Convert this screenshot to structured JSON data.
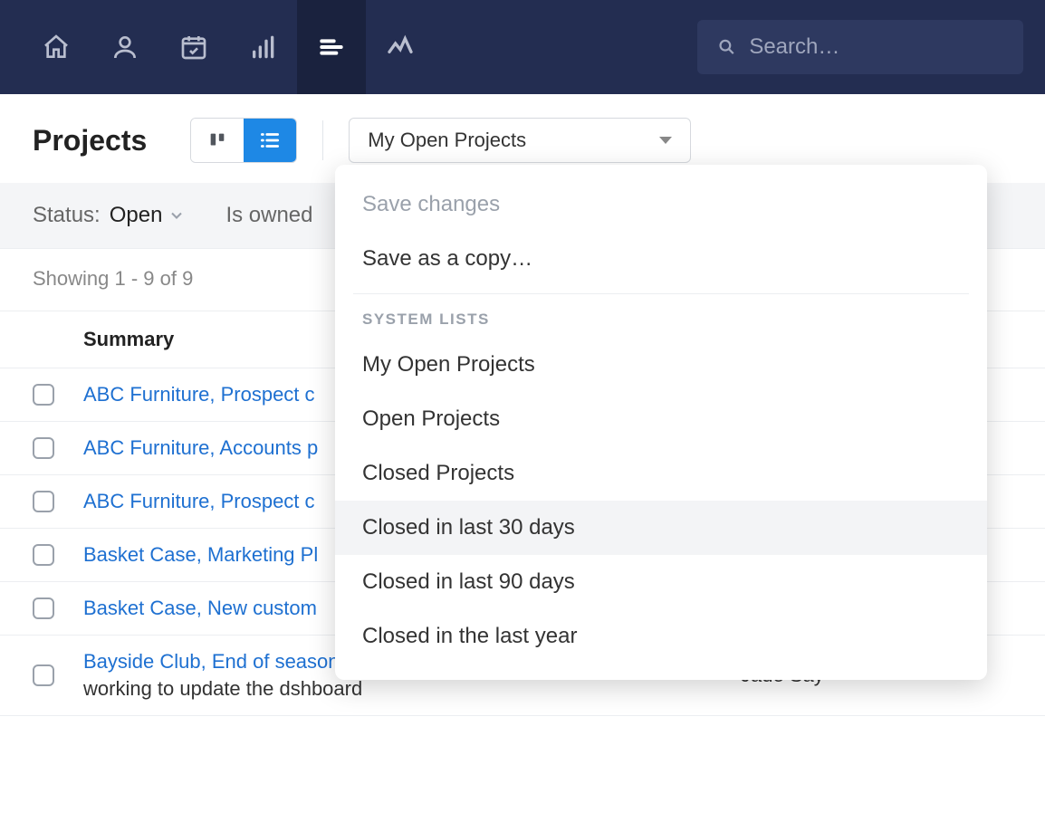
{
  "navbar": {
    "search_placeholder": "Search…"
  },
  "header": {
    "title": "Projects",
    "filter_selected": "My Open Projects"
  },
  "filterbar": {
    "status_label": "Status:",
    "status_value": "Open",
    "owned_partial": "Is owned"
  },
  "results": {
    "count_text": "Showing 1 - 9 of 9"
  },
  "table": {
    "header_summary": "Summary",
    "rows": [
      {
        "summary": "ABC Furniture, Prospect c",
        "sub": "",
        "owner": ""
      },
      {
        "summary": "ABC Furniture, Accounts p",
        "sub": "",
        "owner": ""
      },
      {
        "summary": "ABC Furniture, Prospect c",
        "sub": "",
        "owner": ""
      },
      {
        "summary": "Basket Case, Marketing Pl",
        "sub": "",
        "owner": ""
      },
      {
        "summary": "Basket Case, New custom",
        "sub": "",
        "owner": ""
      },
      {
        "summary": "Bayside Club, End of season sale campaign",
        "sub": "working to update the dshboard",
        "owner": "Jade Say"
      }
    ]
  },
  "dropdown": {
    "save_changes": "Save changes",
    "save_copy": "Save as a copy…",
    "section_heading": "SYSTEM LISTS",
    "items": [
      "My Open Projects",
      "Open Projects",
      "Closed Projects",
      "Closed in last 30 days",
      "Closed in last 90 days",
      "Closed in the last year"
    ],
    "hover_index": 3
  }
}
